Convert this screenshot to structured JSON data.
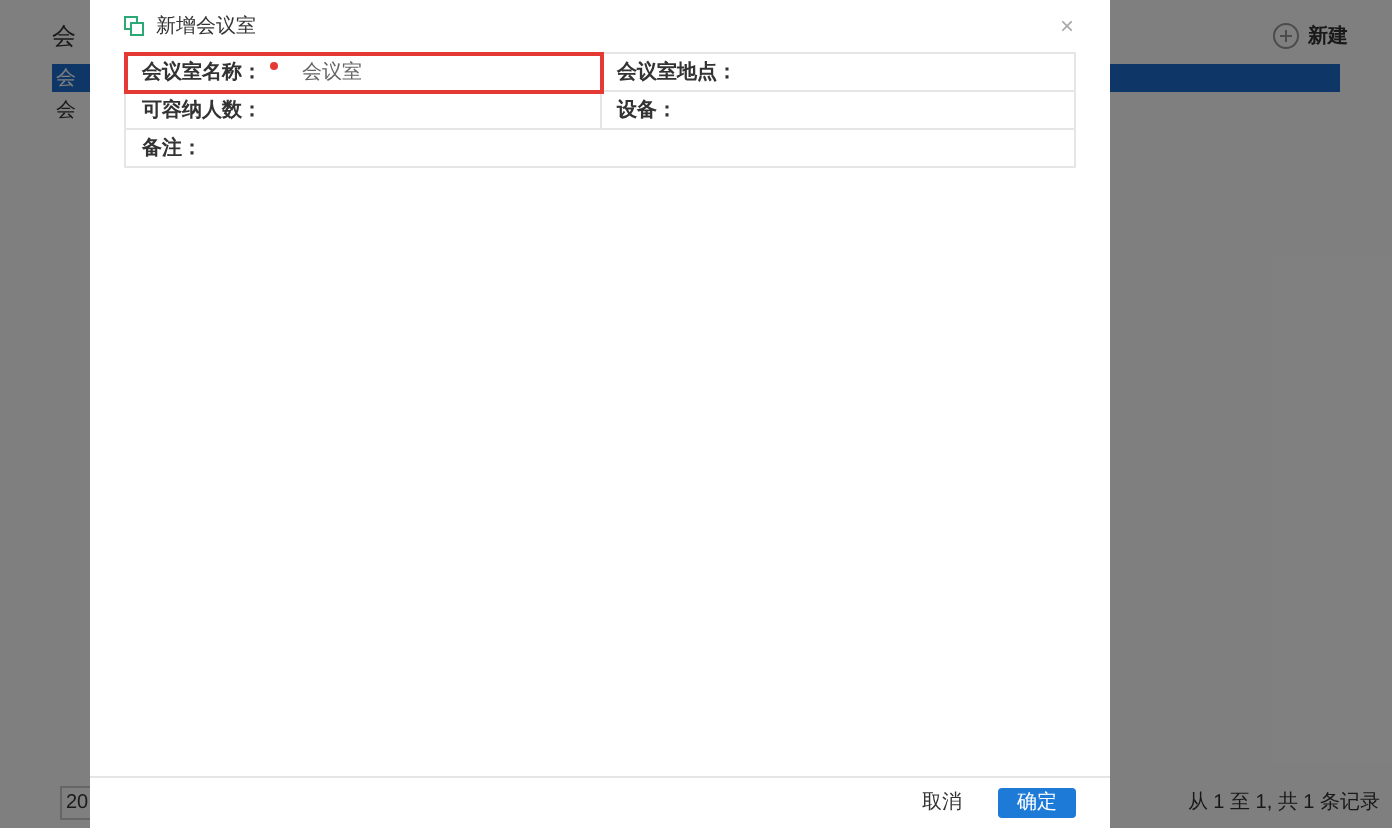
{
  "page": {
    "title": "会",
    "new_button": "新建",
    "tab": "会",
    "row": "会",
    "page_size": "20",
    "pager_info": "从 1 至 1, 共 1 条记录"
  },
  "dialog": {
    "title": "新增会议室",
    "close": "×",
    "rows": [
      [
        {
          "label": "会议室名称：",
          "required": true,
          "value": "会议室",
          "highlighted": true
        },
        {
          "label": "会议室地点：",
          "required": false,
          "highlighted": false
        }
      ],
      [
        {
          "label": "可容纳人数：",
          "required": false,
          "highlighted": false
        },
        {
          "label": "设备：",
          "required": false,
          "highlighted": false
        }
      ],
      [
        {
          "label": "备注：",
          "required": false,
          "highlighted": false
        }
      ]
    ],
    "buttons": [
      {
        "label": "取消",
        "kind": "secondary"
      },
      {
        "label": "确定",
        "kind": "primary"
      }
    ]
  }
}
